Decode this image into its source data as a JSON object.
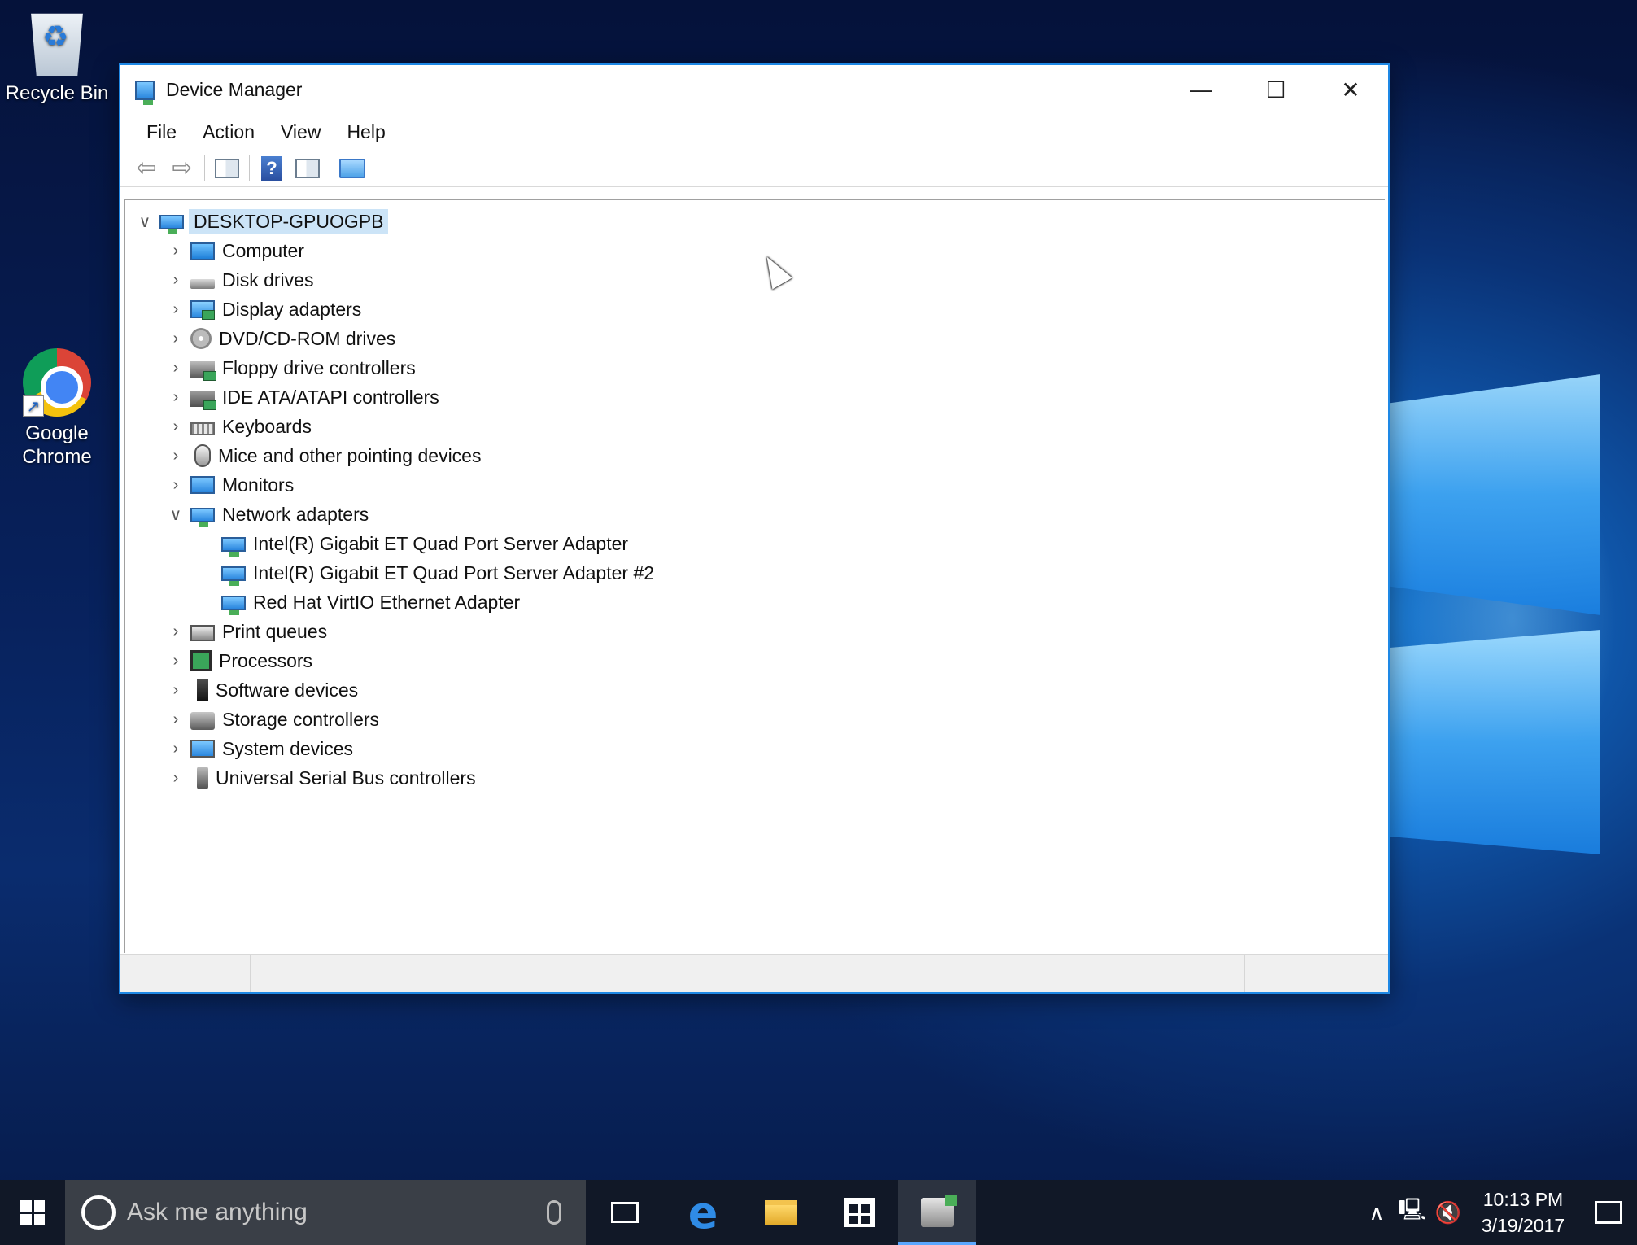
{
  "desktop": {
    "icons": [
      {
        "label": "Recycle Bin"
      },
      {
        "label": "Google Chrome"
      }
    ]
  },
  "window": {
    "title": "Device Manager",
    "controls": {
      "minimize": "—",
      "maximize": "☐",
      "close": "✕"
    },
    "menu": [
      "File",
      "Action",
      "View",
      "Help"
    ],
    "toolbar": [
      "back-icon",
      "forward-icon",
      "show-hide-console-tree-icon",
      "help-icon",
      "show-hide-action-pane-icon",
      "scan-hardware-icon"
    ],
    "tree": {
      "root": "DESKTOP-GPUOGPB",
      "categories": [
        {
          "label": "Computer",
          "icon": "computer-icon"
        },
        {
          "label": "Disk drives",
          "icon": "disk-drive-icon"
        },
        {
          "label": "Display adapters",
          "icon": "display-adapter-icon"
        },
        {
          "label": "DVD/CD-ROM drives",
          "icon": "dvd-drive-icon"
        },
        {
          "label": "Floppy drive controllers",
          "icon": "floppy-controller-icon"
        },
        {
          "label": "IDE ATA/ATAPI controllers",
          "icon": "ide-controller-icon"
        },
        {
          "label": "Keyboards",
          "icon": "keyboard-icon"
        },
        {
          "label": "Mice and other pointing devices",
          "icon": "mouse-icon"
        },
        {
          "label": "Monitors",
          "icon": "monitor-icon"
        },
        {
          "label": "Network adapters",
          "icon": "network-adapter-icon",
          "expanded": true,
          "children": [
            "Intel(R) Gigabit ET Quad Port Server Adapter",
            "Intel(R) Gigabit ET Quad Port Server Adapter #2",
            "Red Hat VirtIO Ethernet Adapter"
          ]
        },
        {
          "label": "Print queues",
          "icon": "printer-icon"
        },
        {
          "label": "Processors",
          "icon": "processor-icon"
        },
        {
          "label": "Software devices",
          "icon": "software-device-icon"
        },
        {
          "label": "Storage controllers",
          "icon": "storage-controller-icon"
        },
        {
          "label": "System devices",
          "icon": "system-device-icon"
        },
        {
          "label": "Universal Serial Bus controllers",
          "icon": "usb-icon"
        }
      ]
    }
  },
  "taskbar": {
    "search_placeholder": "Ask me anything",
    "clock_time": "10:13 PM",
    "clock_date": "3/19/2017"
  },
  "colors": {
    "accent": "#1e88e5",
    "selection": "#cce4f7",
    "taskbar": "#111827"
  }
}
